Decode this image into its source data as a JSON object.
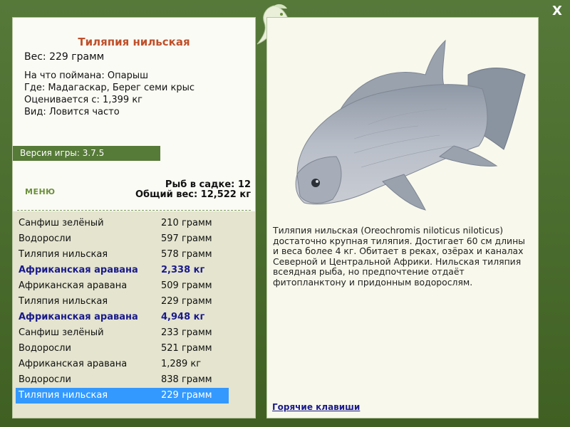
{
  "window": {
    "close_label": "X"
  },
  "fish": {
    "name": "Тиляпия нильская",
    "weight": "Вес: 229 грамм",
    "bait": "На что поймана: Опарыш",
    "place": "Где: Мадагаскар, Берег семи крыс",
    "value": "Оценивается с: 1,399 кг",
    "kind": "Вид: Ловится часто"
  },
  "version": "Версия игры: 3.7.5",
  "menu_label": "МЕНЮ",
  "stats": {
    "count": "Рыб в садке: 12",
    "total": "Общий вес: 12,522 кг"
  },
  "catch_list": [
    {
      "name": "Санфиш зелёный",
      "weight": "210 грамм"
    },
    {
      "name": "Водоросли",
      "weight": "597 грамм"
    },
    {
      "name": "Тиляпия нильская",
      "weight": "578 грамм"
    },
    {
      "name": "Африканская аравана",
      "weight": "2,338 кг"
    },
    {
      "name": "Африканская аравана",
      "weight": "509 грамм"
    },
    {
      "name": "Тиляпия нильская",
      "weight": "229 грамм"
    },
    {
      "name": "Африканская аравана",
      "weight": "4,948 кг"
    },
    {
      "name": "Санфиш зелёный",
      "weight": "233 грамм"
    },
    {
      "name": "Водоросли",
      "weight": "521 грамм"
    },
    {
      "name": "Африканская аравана",
      "weight": "1,289 кг"
    },
    {
      "name": "Водоросли",
      "weight": "838 грамм"
    },
    {
      "name": "Тиляпия нильская",
      "weight": "229 грамм"
    }
  ],
  "description": "Тиляпия нильская (Oreochromis niloticus niloticus) достаточно крупная тиляпия. Достигает 60 см длины и веса более 4 кг. Обитает в реках, озёрах и каналах Северной и Центральной Африки. Нильская тиляпия всеядная рыба, но предпочтение отдаёт фитопланктону и придонным водорослям.",
  "hotkeys_label": "Горячие клавиши"
}
